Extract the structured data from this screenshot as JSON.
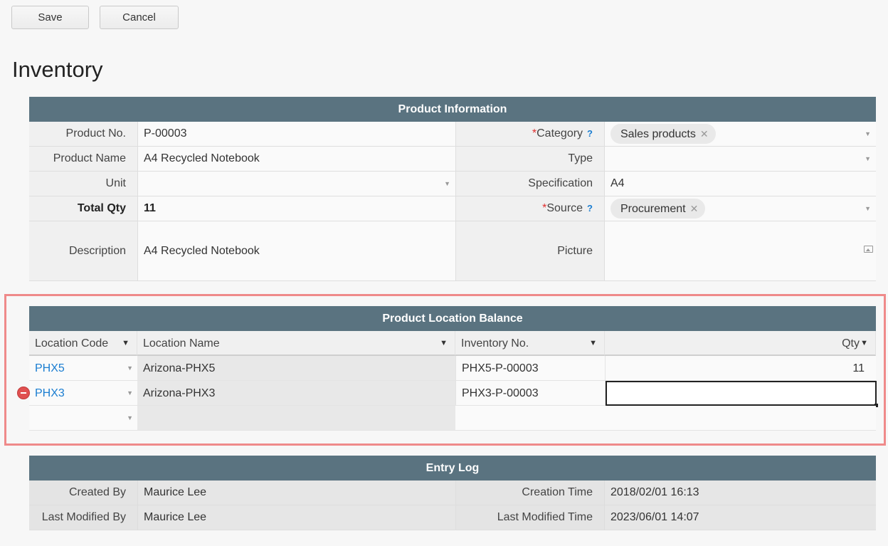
{
  "toolbar": {
    "save_label": "Save",
    "cancel_label": "Cancel"
  },
  "page": {
    "title": "Inventory"
  },
  "product_info": {
    "header": "Product Information",
    "product_no_label": "Product No.",
    "product_no": "P-00003",
    "product_name_label": "Product Name",
    "product_name": "A4 Recycled Notebook",
    "unit_label": "Unit",
    "unit": "",
    "total_qty_label": "Total Qty",
    "total_qty": "11",
    "description_label": "Description",
    "description": "A4 Recycled Notebook",
    "category_label": "Category",
    "category_tag": "Sales products",
    "type_label": "Type",
    "type": "",
    "specification_label": "Specification",
    "specification": "A4",
    "source_label": "Source",
    "source_tag": "Procurement",
    "picture_label": "Picture",
    "required_mark": "*",
    "help_mark": "?",
    "tag_close": "✕"
  },
  "location_balance": {
    "header": "Product Location Balance",
    "columns": {
      "location_code": "Location Code",
      "location_name": "Location Name",
      "inventory_no": "Inventory No.",
      "qty": "Qty"
    },
    "rows": [
      {
        "location_code": "PHX5",
        "location_name": "Arizona-PHX5",
        "inventory_no": "PHX5-P-00003",
        "qty": "11"
      },
      {
        "location_code": "PHX3",
        "location_name": "Arizona-PHX3",
        "inventory_no": "PHX3-P-00003",
        "qty": ""
      }
    ]
  },
  "entry_log": {
    "header": "Entry Log",
    "created_by_label": "Created By",
    "created_by": "Maurice Lee",
    "last_modified_by_label": "Last Modified By",
    "last_modified_by": "Maurice Lee",
    "creation_time_label": "Creation Time",
    "creation_time": "2018/02/01 16:13",
    "last_modified_time_label": "Last Modified Time",
    "last_modified_time": "2023/06/01 14:07"
  },
  "colors": {
    "section_header": "#5a7380",
    "link": "#1a7dd1",
    "highlight": "#ef8a8a",
    "required": "#e03030"
  },
  "icons": [
    "dropdown-caret-icon",
    "help-icon",
    "tag-remove-icon",
    "picture-icon",
    "sort-dropdown-icon",
    "remove-row-icon"
  ]
}
